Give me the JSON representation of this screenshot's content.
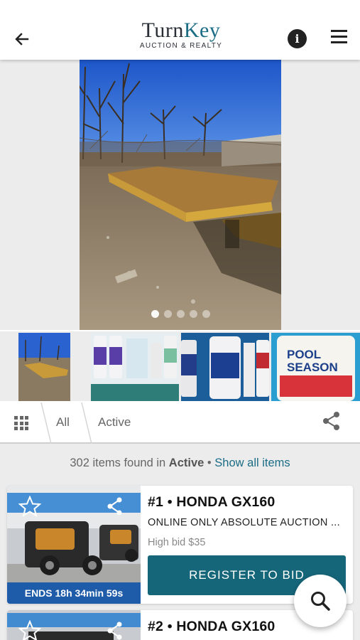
{
  "header": {
    "logo_main_a": "Turn",
    "logo_main_b": "Key",
    "logo_sub": "AUCTION & REALTY",
    "back_icon": "arrow-left-icon",
    "info_icon": "info-icon",
    "info_glyph": "i",
    "menu_icon": "hamburger-menu-icon"
  },
  "gallery": {
    "dots_total": 5,
    "active_dot": 1
  },
  "filter_bar": {
    "tabs": [
      {
        "label": "All"
      },
      {
        "label": "Active"
      }
    ]
  },
  "results": {
    "count_text": "302 items found in",
    "status_word": "Active",
    "separator": "•",
    "show_all_label": "Show all items"
  },
  "items": [
    {
      "title": "#1 • HONDA GX160",
      "auction": "ONLINE ONLY ABSOLUTE AUCTION ...",
      "high_bid": "High bid $35",
      "ends": "ENDS 18h 34min 59s",
      "register_label": "REGISTER TO BID"
    },
    {
      "title": "#2 • HONDA GX160"
    }
  ],
  "colors": {
    "brand_teal": "#16667a",
    "ends_blue": "#1e5ba8",
    "link": "#1b6d86"
  }
}
